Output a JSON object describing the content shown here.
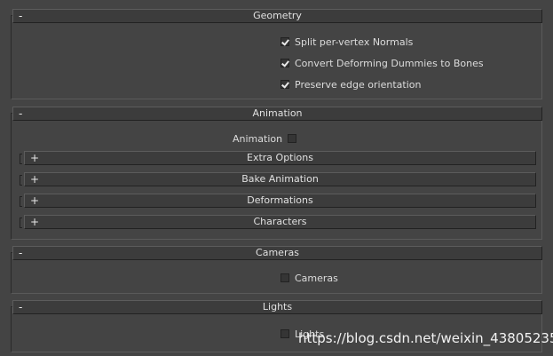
{
  "geometry": {
    "sign": "-",
    "title": "Geometry",
    "options": [
      {
        "label": "Split per-vertex Normals",
        "checked": true
      },
      {
        "label": "Convert Deforming Dummies to Bones",
        "checked": true
      },
      {
        "label": "Preserve edge orientation",
        "checked": true
      }
    ]
  },
  "animation": {
    "sign": "-",
    "title": "Animation",
    "toggle": {
      "label": "Animation",
      "checked": false
    },
    "subrollouts": [
      {
        "sign": "+",
        "title": "Extra Options"
      },
      {
        "sign": "+",
        "title": "Bake Animation"
      },
      {
        "sign": "+",
        "title": "Deformations"
      },
      {
        "sign": "+",
        "title": "Characters"
      }
    ]
  },
  "cameras": {
    "sign": "-",
    "title": "Cameras",
    "option": {
      "label": "Cameras",
      "checked": false
    }
  },
  "lights": {
    "sign": "-",
    "title": "Lights",
    "option": {
      "label": "Lights",
      "checked": false
    }
  },
  "watermark": "https://blog.csdn.net/weixin_43805235"
}
